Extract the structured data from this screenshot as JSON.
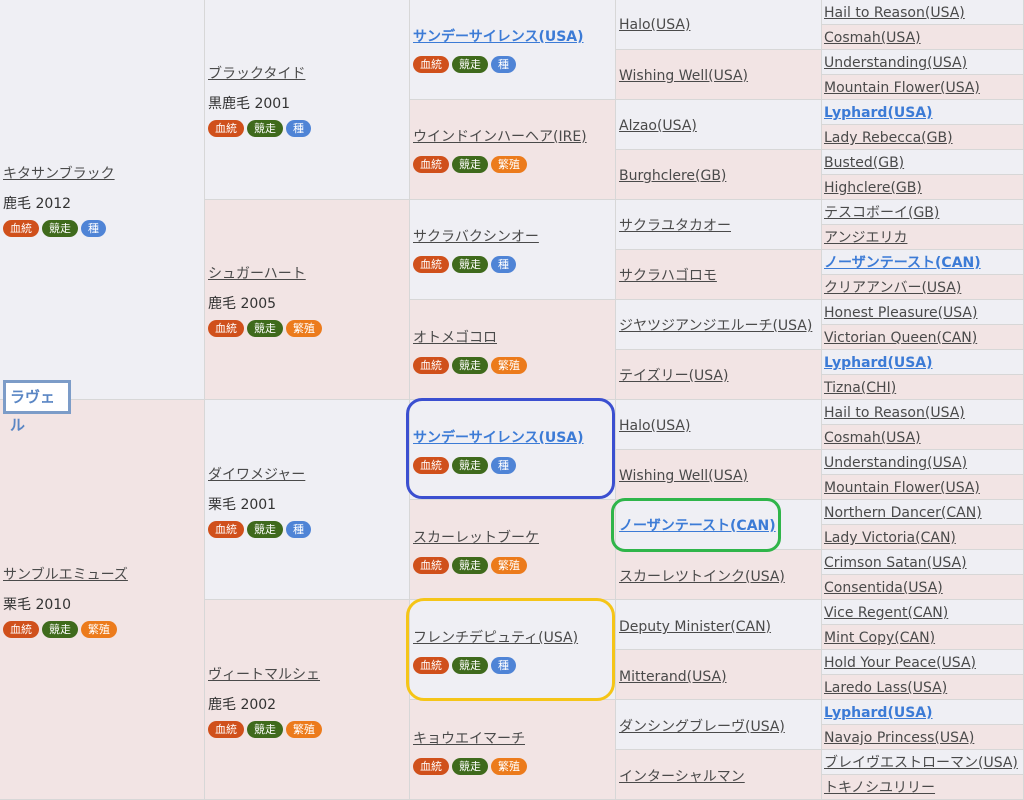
{
  "badges": {
    "ketto": "血統",
    "kyoso": "競走",
    "shu": "種",
    "hanshoku": "繁殖"
  },
  "colors": {
    "sire_bg": "#efeff4",
    "dam_bg": "#f2e4e4",
    "badge_ketto": "#d0501b",
    "badge_kyoso": "#3f6a1c",
    "badge_shu": "#4f84d6",
    "badge_hanshoku": "#ec7b1c",
    "highlight_blue": "#3b4fd0",
    "highlight_green": "#2fb54a",
    "highlight_yellow": "#f5c518",
    "link_blue": "#3c7bd6"
  },
  "target_horse": "ラヴェル",
  "gen1": [
    {
      "name": "キタサンブラック",
      "info": "鹿毛 2012"
    },
    {
      "name": "サンブルエミューズ",
      "info": "栗毛 2010"
    }
  ],
  "gen2": [
    {
      "name": "ブラックタイド",
      "info": "黒鹿毛 2001"
    },
    {
      "name": "シュガーハート",
      "info": "鹿毛 2005"
    },
    {
      "name": "ダイワメジャー",
      "info": "栗毛 2001"
    },
    {
      "name": "ヴィートマルシェ",
      "info": "鹿毛 2002"
    }
  ],
  "gen3": [
    {
      "name": "サンデーサイレンス(USA)"
    },
    {
      "name": "ウインドインハーヘア(IRE)"
    },
    {
      "name": "サクラバクシンオー"
    },
    {
      "name": "オトメゴコロ"
    },
    {
      "name": "サンデーサイレンス(USA)"
    },
    {
      "name": "スカーレットブーケ"
    },
    {
      "name": "フレンチデピュティ(USA)"
    },
    {
      "name": "キョウエイマーチ"
    }
  ],
  "gen4": [
    "Halo(USA)",
    "Wishing Well(USA)",
    "Alzao(USA)",
    "Burghclere(GB)",
    "サクラユタカオー",
    "サクラハゴロモ",
    "ジヤツジアンジエルーチ(USA)",
    "テイズリー(USA)",
    "Halo(USA)",
    "Wishing Well(USA)",
    "ノーザンテースト(CAN)",
    "スカーレツトインク(USA)",
    "Deputy Minister(CAN)",
    "Mitterand(USA)",
    "ダンシングブレーヴ(USA)",
    "インターシャルマン"
  ],
  "gen5": [
    "Hail to Reason(USA)",
    "Cosmah(USA)",
    "Understanding(USA)",
    "Mountain Flower(USA)",
    "Lyphard(USA)",
    "Lady Rebecca(GB)",
    "Busted(GB)",
    "Highclere(GB)",
    "テスコボーイ(GB)",
    "アンジエリカ",
    "ノーザンテースト(CAN)",
    "クリアアンバー(USA)",
    "Honest Pleasure(USA)",
    "Victorian Queen(CAN)",
    "Lyphard(USA)",
    "Tizna(CHI)",
    "Hail to Reason(USA)",
    "Cosmah(USA)",
    "Understanding(USA)",
    "Mountain Flower(USA)",
    "Northern Dancer(CAN)",
    "Lady Victoria(CAN)",
    "Crimson Satan(USA)",
    "Consentida(USA)",
    "Vice Regent(CAN)",
    "Mint Copy(CAN)",
    "Hold Your Peace(USA)",
    "Laredo Lass(USA)",
    "Lyphard(USA)",
    "Navajo Princess(USA)",
    "ブレイヴエストローマン(USA)",
    "トキノシユリリー"
  ]
}
